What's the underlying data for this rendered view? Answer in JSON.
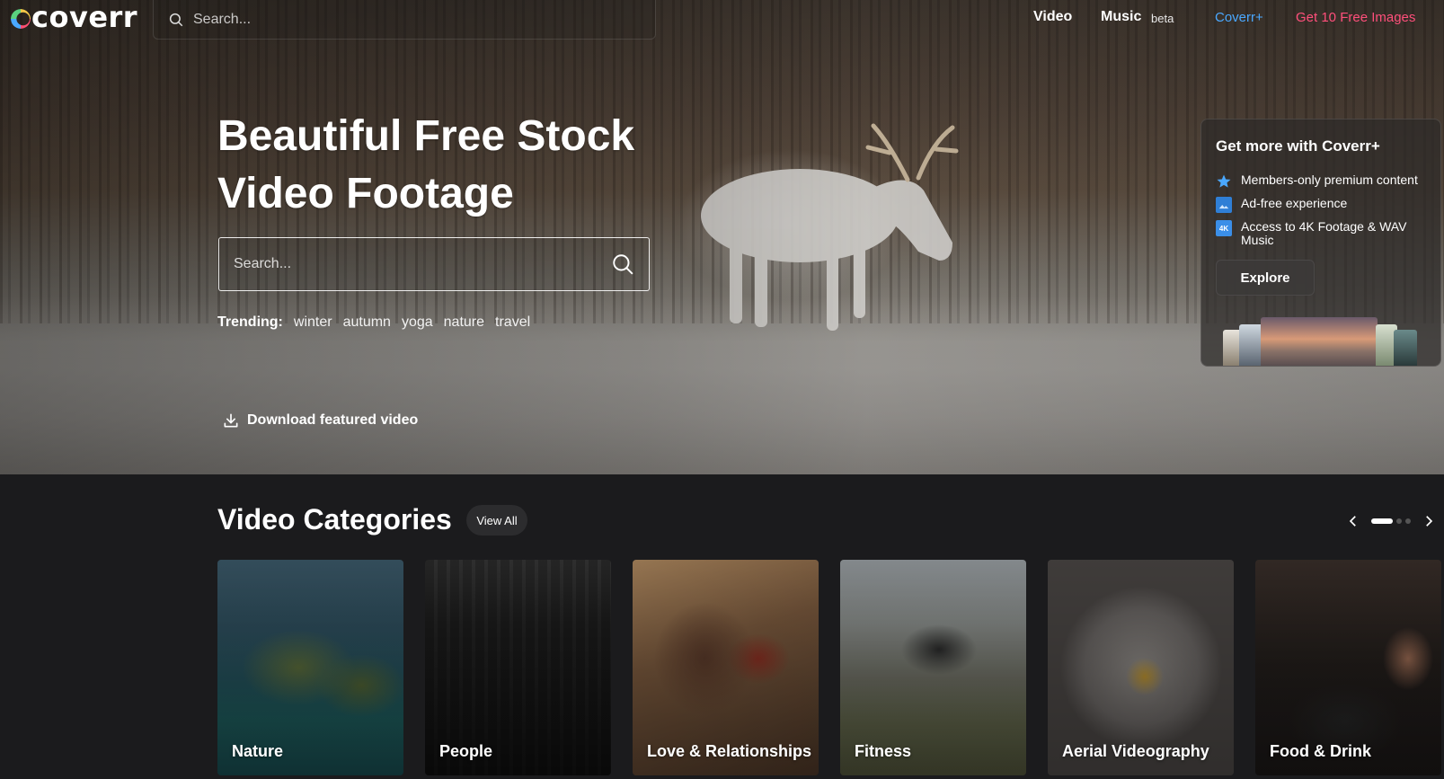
{
  "header": {
    "logo_text": "coverr",
    "search_placeholder": "Search...",
    "nav": {
      "video": "Video",
      "music": "Music",
      "beta": "beta",
      "coverr_plus": "Coverr+",
      "free_images": "Get 10 Free Images"
    }
  },
  "hero": {
    "title_line1": "Beautiful Free Stock",
    "title_line2": "Video Footage",
    "search_placeholder": "Search...",
    "trending_label": "Trending:",
    "trending": [
      "winter",
      "autumn",
      "yoga",
      "nature",
      "travel"
    ],
    "download_label": "Download featured video"
  },
  "promo": {
    "title": "Get more with Coverr+",
    "features": [
      {
        "icon": "star-icon",
        "text": "Members-only premium content"
      },
      {
        "icon": "image-icon",
        "text": "Ad-free experience"
      },
      {
        "icon": "4k-icon",
        "badge": "4K",
        "text": "Access to 4K Footage & WAV Music"
      }
    ],
    "button": "Explore"
  },
  "categories": {
    "title": "Video Categories",
    "view_all": "View All",
    "items": [
      "Nature",
      "People",
      "Love & Relationships",
      "Fitness",
      "Aerial Videography",
      "Food & Drink"
    ]
  },
  "colors": {
    "accent_blue": "#4aa8ff",
    "accent_pink": "#ff4f7b",
    "background": "#1b1b1d"
  }
}
